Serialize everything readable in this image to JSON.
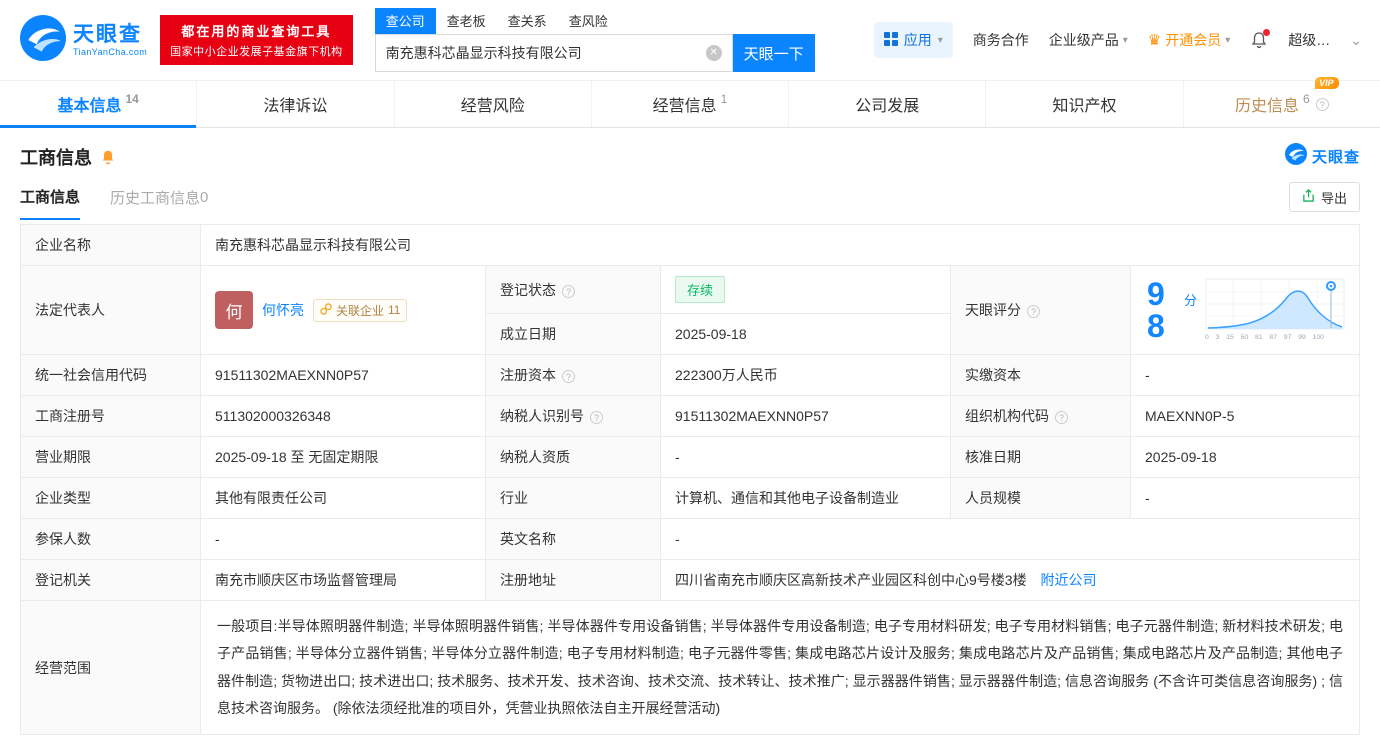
{
  "icons": {
    "help": "?",
    "caret": "▾",
    "caret_down": "⌄",
    "clear": "✕",
    "crown": "♛"
  },
  "header": {
    "logo": {
      "brand": "天眼查",
      "domain": "TianYanCha.com"
    },
    "slogan": {
      "line1": "都在用的商业查询工具",
      "line2": "国家中小企业发展子基金旗下机构"
    },
    "search": {
      "tabs": [
        {
          "label": "查公司"
        },
        {
          "label": "查老板"
        },
        {
          "label": "查关系"
        },
        {
          "label": "查风险"
        }
      ],
      "value": "南充惠科芯晶显示科技有限公司",
      "button": "天眼一下"
    },
    "right": {
      "apps": "应用",
      "business": "商务合作",
      "enterprise": "企业级产品",
      "vip": "开通会员",
      "super": "超级…"
    }
  },
  "nav": {
    "vip_label": "VIP",
    "tabs": [
      {
        "label": "基本信息",
        "count": "14"
      },
      {
        "label": "法律诉讼",
        "count": ""
      },
      {
        "label": "经营风险",
        "count": ""
      },
      {
        "label": "经营信息",
        "count": "1"
      },
      {
        "label": "公司发展",
        "count": ""
      },
      {
        "label": "知识产权",
        "count": ""
      },
      {
        "label": "历史信息",
        "count": "6"
      }
    ]
  },
  "section": {
    "title": "工商信息",
    "brand": "天眼查",
    "subtabs": [
      {
        "label": "工商信息"
      },
      {
        "label": "历史工商信息",
        "count": "0"
      }
    ],
    "export": "导出"
  },
  "table": {
    "company_name": {
      "label": "企业名称",
      "value": "南充惠科芯晶显示科技有限公司"
    },
    "legal_rep": {
      "label": "法定代表人",
      "avatar": "何",
      "name": "何怀亮",
      "related_label": "关联企业",
      "related_count": "11"
    },
    "reg_status": {
      "label": "登记状态",
      "value": "存续"
    },
    "establish_date": {
      "label": "成立日期",
      "value": "2025-09-18"
    },
    "tyc_score": {
      "label": "天眼评分",
      "value": "98",
      "unit": "分",
      "ticks": [
        "0",
        "3",
        "15",
        "50",
        "81",
        "87",
        "97",
        "99",
        "100"
      ]
    },
    "credit_code": {
      "label": "统一社会信用代码",
      "value": "91511302MAEXNN0P57"
    },
    "reg_capital": {
      "label": "注册资本",
      "value": "222300万人民币"
    },
    "paid_capital": {
      "label": "实缴资本",
      "value": "-"
    },
    "reg_number": {
      "label": "工商注册号",
      "value": "511302000326348"
    },
    "taxpayer_id": {
      "label": "纳税人识别号",
      "value": "91511302MAEXNN0P57"
    },
    "org_code": {
      "label": "组织机构代码",
      "value": "MAEXNN0P-5"
    },
    "business_term": {
      "label": "营业期限",
      "value": "2025-09-18 至 无固定期限"
    },
    "taxpayer_quality": {
      "label": "纳税人资质",
      "value": "-"
    },
    "approval_date": {
      "label": "核准日期",
      "value": "2025-09-18"
    },
    "company_type": {
      "label": "企业类型",
      "value": "其他有限责任公司"
    },
    "industry": {
      "label": "行业",
      "value": "计算机、通信和其他电子设备制造业"
    },
    "staff_size": {
      "label": "人员规模",
      "value": "-"
    },
    "insured_count": {
      "label": "参保人数",
      "value": "-"
    },
    "english_name": {
      "label": "英文名称",
      "value": "-"
    },
    "reg_authority": {
      "label": "登记机关",
      "value": "南充市顺庆区市场监督管理局"
    },
    "reg_address": {
      "label": "注册地址",
      "value": "四川省南充市顺庆区高新技术产业园区科创中心9号楼3楼",
      "link": "附近公司"
    },
    "business_scope": {
      "label": "经营范围",
      "value": "一般项目:半导体照明器件制造; 半导体照明器件销售; 半导体器件专用设备销售; 半导体器件专用设备制造; 电子专用材料研发; 电子专用材料销售; 电子元器件制造; 新材料技术研发; 电子产品销售; 半导体分立器件销售; 半导体分立器件制造; 电子专用材料制造; 电子元器件零售; 集成电路芯片设计及服务; 集成电路芯片及产品销售; 集成电路芯片及产品制造; 其他电子器件制造; 货物进出口; 技术进出口; 技术服务、技术开发、技术咨询、技术交流、技术转让、技术推广; 显示器器件销售; 显示器器件制造; 信息咨询服务 (不含许可类信息咨询服务) ; 信息技术咨询服务。 (除依法须经批准的项目外，凭营业执照依法自主开展经营活动)"
    }
  }
}
